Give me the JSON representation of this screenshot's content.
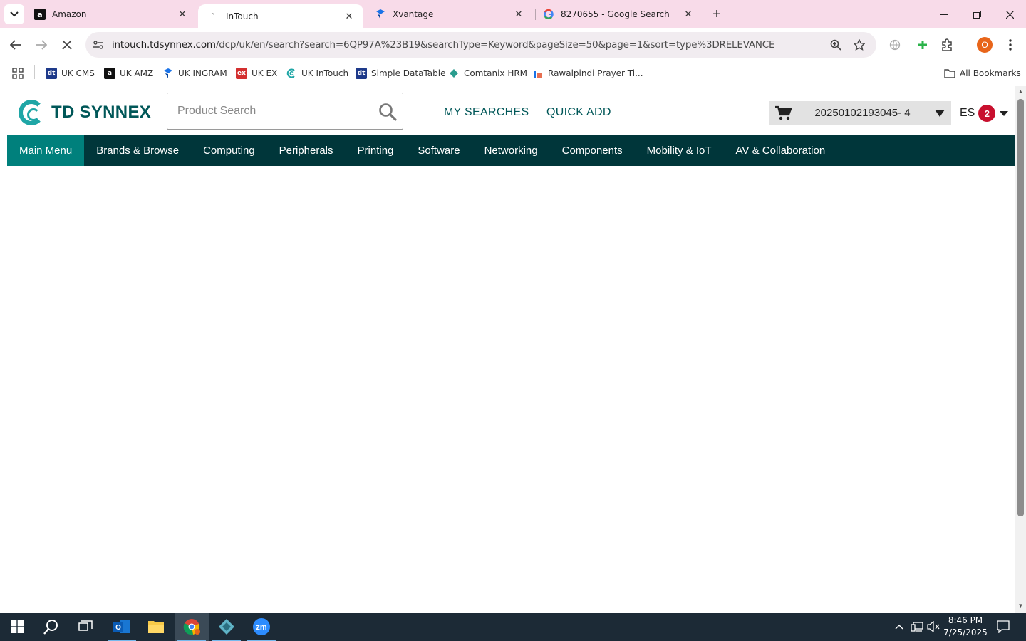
{
  "browser": {
    "tabs": [
      {
        "title": "Amazon",
        "favicon": "amazon-a-icon",
        "active": false
      },
      {
        "title": "InTouch",
        "favicon": "loading-icon",
        "active": true
      },
      {
        "title": "Xvantage",
        "favicon": "xvantage-icon",
        "active": false
      },
      {
        "title": "8270655 - Google Search",
        "favicon": "google-icon",
        "active": false
      }
    ],
    "url_host": "intouch.tdsynnex.com",
    "url_path": "/dcp/uk/en/search?search=6QP97A%23B19&searchType=Keyword&pageSize=50&page=1&sort=type%3DRELEVANCE",
    "profile_initial": "O",
    "bookmarks": [
      {
        "label": "UK CMS",
        "icon_color": "#1e3a8a",
        "icon_text": "dt"
      },
      {
        "label": "UK AMZ",
        "icon_color": "#111111",
        "icon_text": "a"
      },
      {
        "label": "UK INGRAM",
        "icon_color": "#1a73e8",
        "icon_text": ""
      },
      {
        "label": "UK EX",
        "icon_color": "#d32f2f",
        "icon_text": "ex"
      },
      {
        "label": "UK InTouch",
        "icon_color": "#1fa6a6",
        "icon_text": ""
      },
      {
        "label": "Simple DataTable",
        "icon_color": "#1e3a8a",
        "icon_text": "dt"
      },
      {
        "label": "Comtanix HRM",
        "icon_color": "#2a9d8f",
        "icon_text": ""
      },
      {
        "label": "Rawalpindi Prayer Ti...",
        "icon_color": "#e76f51",
        "icon_text": ""
      }
    ],
    "all_bookmarks_label": "All Bookmarks"
  },
  "header": {
    "brand": "TD SYNNEX",
    "search_placeholder": "Product Search",
    "links": {
      "my_searches": "MY SEARCHES",
      "quick_add": "QUICK ADD"
    },
    "cart_id": "20250102193045- 4",
    "user_initials": "ES",
    "notification_count": "2"
  },
  "menu": {
    "items": [
      {
        "label": "Main Menu",
        "active": true
      },
      {
        "label": "Brands & Browse",
        "active": false
      },
      {
        "label": "Computing",
        "active": false
      },
      {
        "label": "Peripherals",
        "active": false
      },
      {
        "label": "Printing",
        "active": false
      },
      {
        "label": "Software",
        "active": false
      },
      {
        "label": "Networking",
        "active": false
      },
      {
        "label": "Components",
        "active": false
      },
      {
        "label": "Mobility & IoT",
        "active": false
      },
      {
        "label": "AV & Collaboration",
        "active": false
      }
    ]
  },
  "taskbar": {
    "time": "8:46 PM",
    "date": "7/25/2025"
  },
  "colors": {
    "brand_teal": "#005758",
    "menu_bg": "#00363a",
    "menu_active": "#00807c",
    "badge_red": "#c8102e",
    "tabstrip_bg": "#f8dbe9"
  }
}
